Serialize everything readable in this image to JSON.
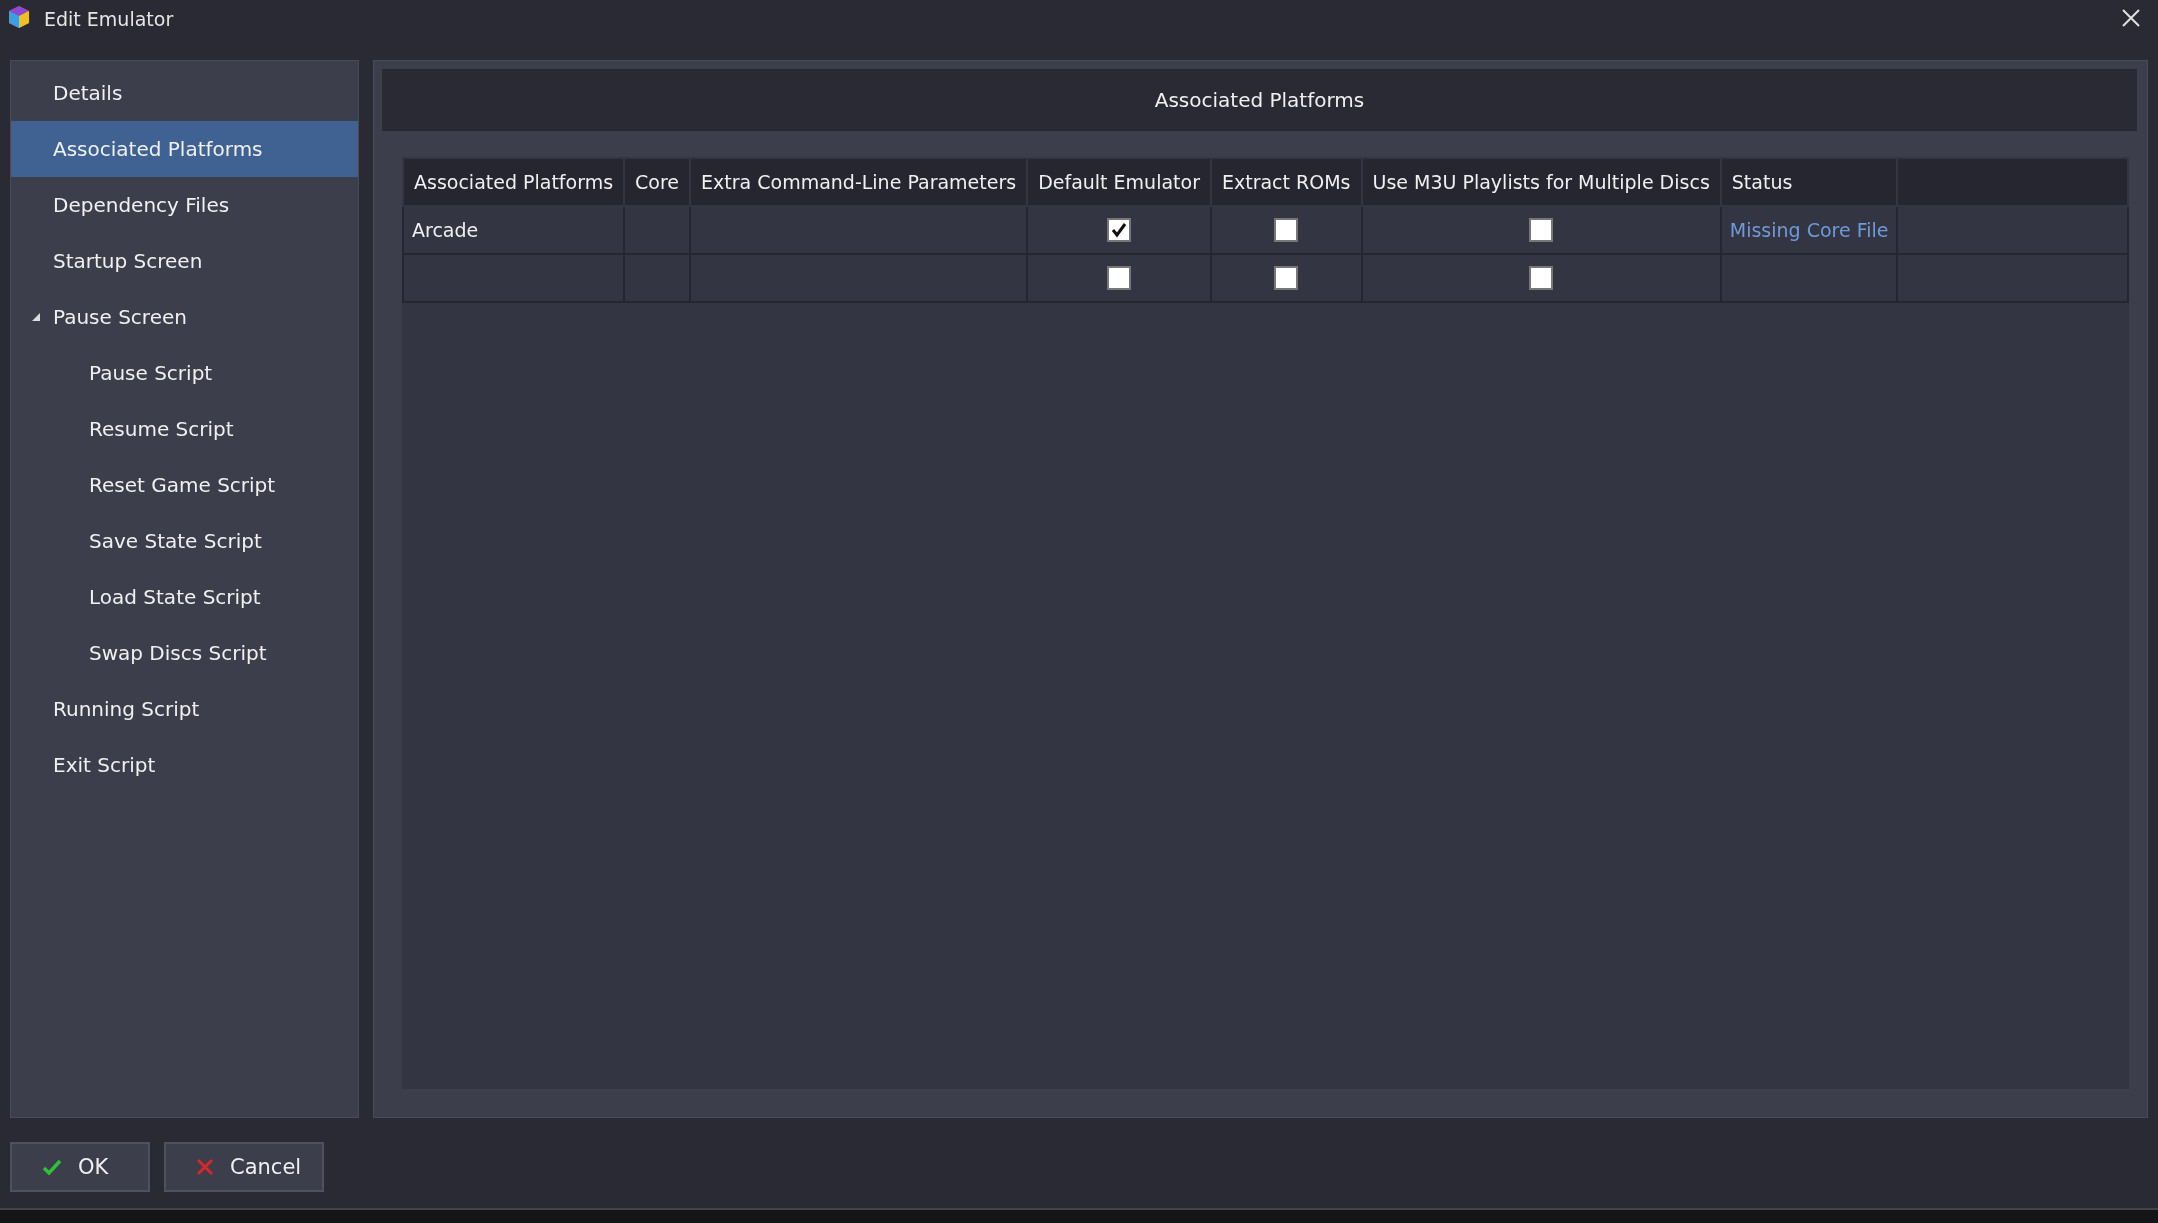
{
  "window": {
    "title": "Edit Emulator"
  },
  "sidebar": {
    "items": [
      {
        "label": "Details",
        "selected": false
      },
      {
        "label": "Associated Platforms",
        "selected": true
      },
      {
        "label": "Dependency Files",
        "selected": false
      },
      {
        "label": "Startup Screen",
        "selected": false
      },
      {
        "label": "Pause Screen",
        "selected": false,
        "expanded": true,
        "children": [
          {
            "label": "Pause Script",
            "selected": false
          },
          {
            "label": "Resume Script",
            "selected": false
          },
          {
            "label": "Reset Game Script",
            "selected": false
          },
          {
            "label": "Save State Script",
            "selected": false
          },
          {
            "label": "Load State Script",
            "selected": false
          },
          {
            "label": "Swap Discs Script",
            "selected": false
          }
        ]
      },
      {
        "label": "Running Script",
        "selected": false
      },
      {
        "label": "Exit Script",
        "selected": false
      }
    ]
  },
  "panel": {
    "title": "Associated Platforms"
  },
  "table": {
    "columns": [
      "Associated Platforms",
      "Core",
      "Extra Command-Line Parameters",
      "Default Emulator",
      "Extract ROMs",
      "Use M3U Playlists for Multiple Discs",
      "Status"
    ],
    "rows": [
      {
        "platform": "Arcade",
        "default_emulator": true,
        "extract_roms": false,
        "use_m3u": false,
        "status": "Missing Core File"
      },
      {
        "default_emulator": false,
        "extract_roms": false,
        "use_m3u": false
      }
    ]
  },
  "buttons": [
    {
      "kind": "ok",
      "label": "OK"
    },
    {
      "kind": "cancel",
      "label": "Cancel"
    }
  ]
}
